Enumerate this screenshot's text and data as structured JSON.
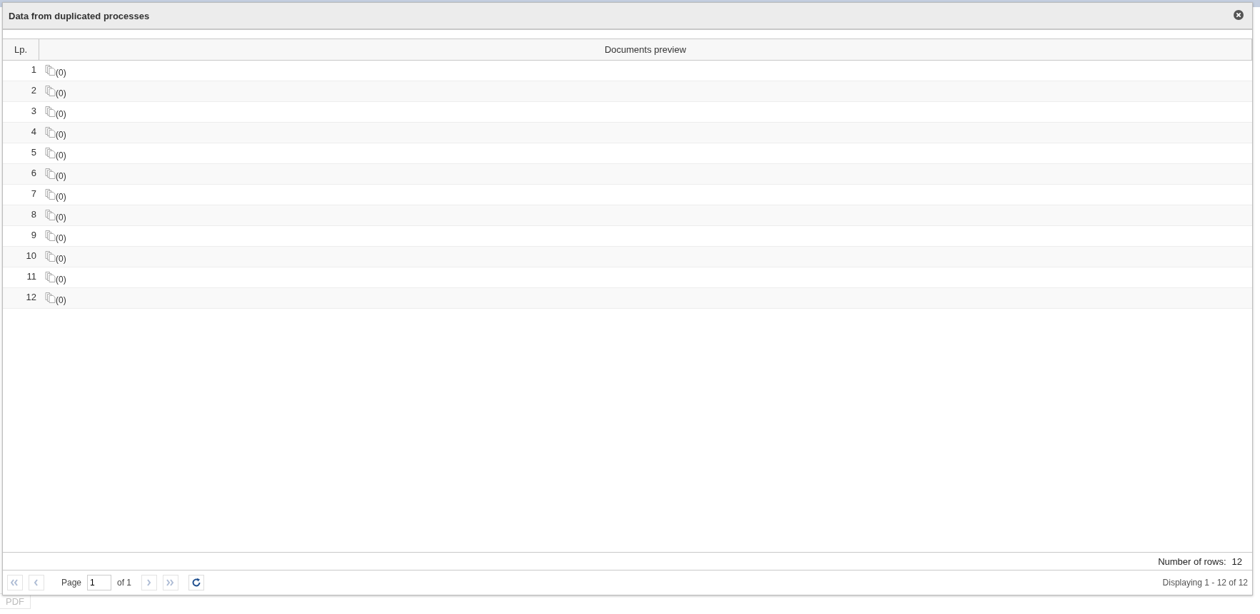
{
  "dialog": {
    "title": "Data from duplicated processes"
  },
  "table": {
    "columns": [
      "Lp.",
      "Documents preview"
    ],
    "rows": [
      {
        "lp": "1",
        "preview": "(0)"
      },
      {
        "lp": "2",
        "preview": "(0)"
      },
      {
        "lp": "3",
        "preview": "(0)"
      },
      {
        "lp": "4",
        "preview": "(0)"
      },
      {
        "lp": "5",
        "preview": "(0)"
      },
      {
        "lp": "6",
        "preview": "(0)"
      },
      {
        "lp": "7",
        "preview": "(0)"
      },
      {
        "lp": "8",
        "preview": "(0)"
      },
      {
        "lp": "9",
        "preview": "(0)"
      },
      {
        "lp": "10",
        "preview": "(0)"
      },
      {
        "lp": "11",
        "preview": "(0)"
      },
      {
        "lp": "12",
        "preview": "(0)"
      }
    ]
  },
  "summary": {
    "label": "Number of rows:",
    "value": "12"
  },
  "pager": {
    "first_disabled": true,
    "prev_disabled": true,
    "page_label": "Page",
    "page_value": "1",
    "of_label": "of 1",
    "next_disabled": true,
    "last_disabled": true,
    "displaying": "Displaying 1 - 12 of 12"
  },
  "background": {
    "button": "PDF"
  }
}
